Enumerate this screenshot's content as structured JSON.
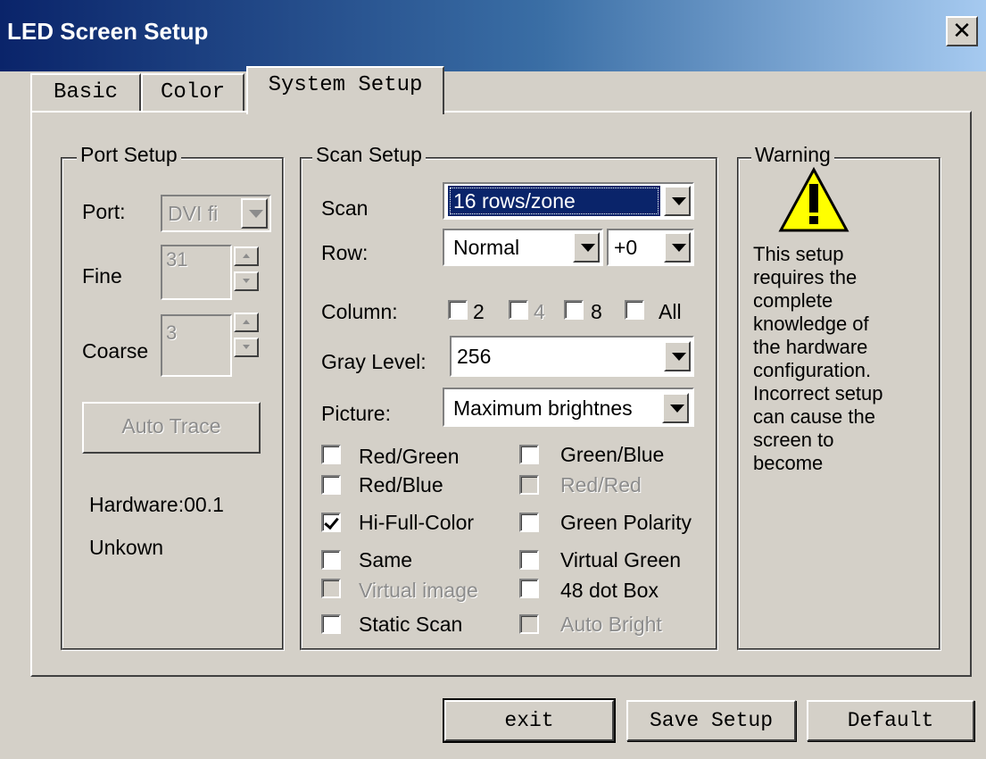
{
  "window": {
    "title": "LED Screen Setup",
    "close_glyph": "✕"
  },
  "tabs": [
    {
      "label": "Basic"
    },
    {
      "label": "Color"
    },
    {
      "label": "System Setup",
      "active": true
    }
  ],
  "port_setup": {
    "title": "Port Setup",
    "port_label": "Port:",
    "port_value": "DVI fi",
    "fine_label": "Fine",
    "fine_value": "31",
    "coarse_label": "Coarse",
    "coarse_value": "3",
    "auto_trace_label": "Auto Trace",
    "hardware_text": "Hardware:00.1",
    "status_text": "Unkown"
  },
  "scan_setup": {
    "title": "Scan Setup",
    "scan_label": "Scan",
    "scan_value": "16 rows/zone",
    "row_label": "Row:",
    "row_value": "Normal",
    "row_offset_value": "+0",
    "column_label": "Column:",
    "column_options": [
      "2",
      "4",
      "8",
      "All"
    ],
    "gray_label": "Gray Level:",
    "gray_value": "256",
    "picture_label": "Picture:",
    "picture_value": "Maximum brightnes",
    "checkboxes": [
      {
        "label": "Red/Green",
        "checked": false,
        "disabled": false
      },
      {
        "label": "Green/Blue",
        "checked": false,
        "disabled": false
      },
      {
        "label": "Red/Blue",
        "checked": false,
        "disabled": false
      },
      {
        "label": "Red/Red",
        "checked": false,
        "disabled": true
      },
      {
        "label": "Hi-Full-Color",
        "checked": true,
        "disabled": false
      },
      {
        "label": "Green Polarity",
        "checked": false,
        "disabled": false
      },
      {
        "label": "Same",
        "checked": false,
        "disabled": false
      },
      {
        "label": "Virtual Green",
        "checked": false,
        "disabled": false
      },
      {
        "label": "Virtual image",
        "checked": false,
        "disabled": true
      },
      {
        "label": "48 dot Box",
        "checked": false,
        "disabled": false
      },
      {
        "label": "Static Scan",
        "checked": false,
        "disabled": false
      },
      {
        "label": "Auto Bright",
        "checked": false,
        "disabled": true
      }
    ]
  },
  "warning": {
    "title": "Warning",
    "icon": "warning-triangle-icon",
    "lines": [
      "This setup",
      "requires the",
      "complete",
      "knowledge of",
      "the hardware",
      "configuration.",
      "Incorrect setup",
      "can cause the",
      "screen to",
      "become"
    ]
  },
  "footer": {
    "exit_label": "exit",
    "save_label": "Save Setup",
    "default_label": "Default"
  },
  "colors": {
    "titlebar_start": "#0a246a",
    "titlebar_end": "#a6caf0",
    "face": "#d4d0c8",
    "selection": "#0a246a",
    "warning_yellow": "#ffff00"
  }
}
